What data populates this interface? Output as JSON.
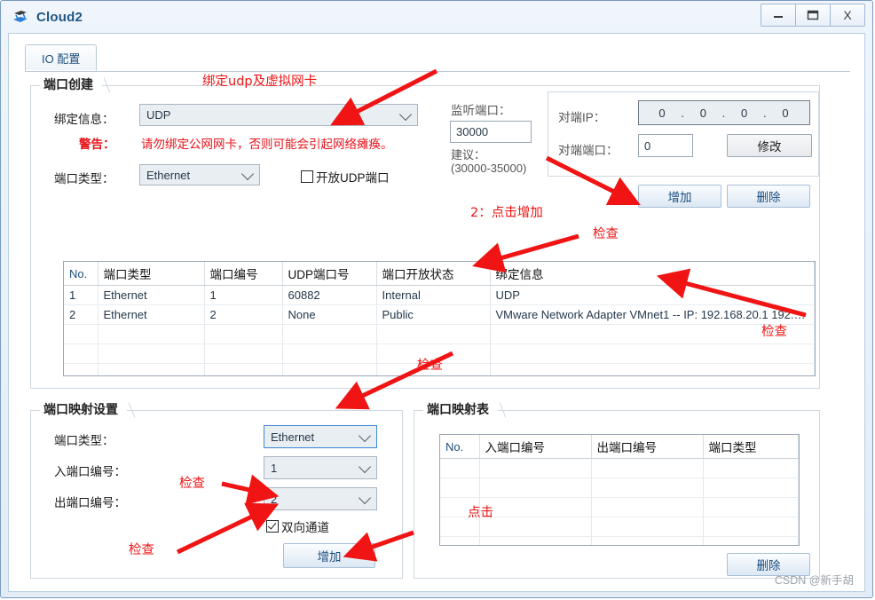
{
  "window": {
    "title": "Cloud2",
    "icon": "cloud-device-icon",
    "buttons": {
      "minimize": "–",
      "maximize": "❐",
      "close": "X"
    }
  },
  "tabs": [
    {
      "label": "IO 配置"
    }
  ],
  "port_create": {
    "title": "端口创建",
    "bind_info_label": "绑定信息：",
    "bind_info_value": "UDP",
    "warning_label": "警告：",
    "warning_text": "请勿绑定公网网卡，否则可能会引起网络瘫痪。",
    "port_type_label": "端口类型：",
    "port_type_value": "Ethernet",
    "open_udp_checkbox_label": "开放UDP端口",
    "open_udp_checked": false,
    "listen_port_label": "监听端口：",
    "listen_port_value": "30000",
    "suggest_label": "建议：",
    "suggest_range": "(30000-35000)",
    "peer_ip_label": "对端IP：",
    "peer_ip_octets": [
      "0",
      "0",
      "0",
      "0"
    ],
    "peer_port_label": "对端端口：",
    "peer_port_value": "0",
    "modify_button": "修改",
    "add_button": "增加",
    "delete_button": "删除"
  },
  "port_table": {
    "headers": [
      "No.",
      "端口类型",
      "端口编号",
      "UDP端口号",
      "端口开放状态",
      "绑定信息"
    ],
    "rows": [
      [
        "1",
        "Ethernet",
        "1",
        "60882",
        "Internal",
        "UDP"
      ],
      [
        "2",
        "Ethernet",
        "2",
        "None",
        "Public",
        "VMware Network Adapter VMnet1 -- IP: 192.168.20.1 192.168…"
      ]
    ],
    "empty_rows": 5
  },
  "port_mapping_settings": {
    "title": "端口映射设置",
    "port_type_label": "端口类型：",
    "port_type_value": "Ethernet",
    "in_port_label": "入端口编号：",
    "in_port_value": "1",
    "out_port_label": "出端口编号：",
    "out_port_value": "2",
    "duplex_checkbox_label": "双向通道",
    "duplex_checked": true,
    "add_button": "增加"
  },
  "port_mapping_table": {
    "title": "端口映射表",
    "headers": [
      "No.",
      "入端口编号",
      "出端口编号",
      "端口类型"
    ],
    "rows": [],
    "empty_rows": 5,
    "delete_button": "删除"
  },
  "annotations": [
    {
      "id": "bind-udp-nic",
      "text": "绑定udp及虚拟网卡"
    },
    {
      "id": "click-add",
      "text": "2：点击增加"
    },
    {
      "id": "check-bind-info",
      "text": "检查"
    },
    {
      "id": "check-vmware-row",
      "text": "检查"
    },
    {
      "id": "check-mapping-settings",
      "text": "检查"
    },
    {
      "id": "check-out-port",
      "text": "检查"
    },
    {
      "id": "check-duplex",
      "text": "检查"
    },
    {
      "id": "click-mapping-table",
      "text": "点击"
    }
  ],
  "watermark": "CSDN @新手胡",
  "colors": {
    "annotation_red": "#f01414",
    "warning_red": "#e8131a",
    "title_blue": "#1f5582",
    "accent_blue": "#3c86d6"
  }
}
